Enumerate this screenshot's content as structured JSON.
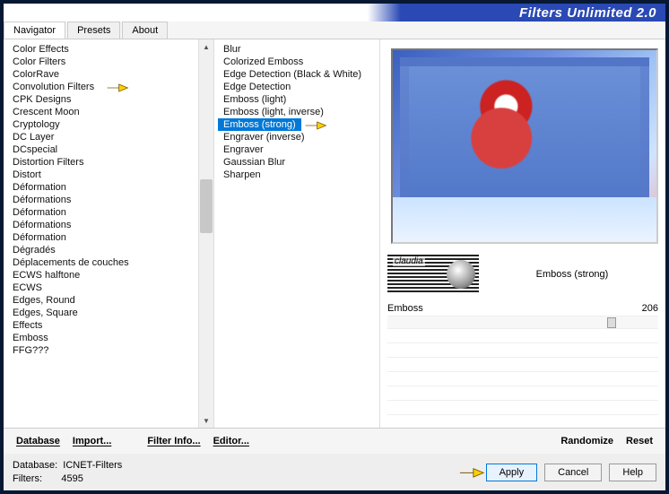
{
  "app_title": "Filters Unlimited 2.0",
  "tabs": {
    "navigator": "Navigator",
    "presets": "Presets",
    "about": "About"
  },
  "left_list": [
    "Color Effects",
    "Color Filters",
    "ColorRave",
    "Convolution Filters",
    "CPK Designs",
    "Crescent Moon",
    "Cryptology",
    "DC Layer",
    "DCspecial",
    "Distortion Filters",
    "Distort",
    "Déformation",
    "Déformations",
    "Déformation",
    "Déformations",
    "Déformation",
    "Dégradés",
    "Déplacements de couches",
    "ECWS halftone",
    "ECWS",
    "Edges, Round",
    "Edges, Square",
    "Effects",
    "Emboss",
    "FFG???"
  ],
  "left_highlight_index": 3,
  "mid_list": [
    "Blur",
    "Colorized Emboss",
    "Edge Detection (Black & White)",
    "Edge Detection",
    "Emboss (light)",
    "Emboss (light, inverse)",
    "Emboss (strong)",
    "Engraver (inverse)",
    "Engraver",
    "Gaussian Blur",
    "Sharpen"
  ],
  "mid_selected_index": 6,
  "logo_text": "claudia",
  "filter_title": "Emboss (strong)",
  "slider": {
    "label": "Emboss",
    "value": "206",
    "pct": 81
  },
  "buttons_row": {
    "database": "Database",
    "import": "Import...",
    "filter_info": "Filter Info...",
    "editor": "Editor...",
    "randomize": "Randomize",
    "reset": "Reset"
  },
  "status": {
    "db_label": "Database:",
    "db_value": "ICNET-Filters",
    "filters_label": "Filters:",
    "filters_value": "4595"
  },
  "action_buttons": {
    "apply": "Apply",
    "cancel": "Cancel",
    "help": "Help"
  }
}
